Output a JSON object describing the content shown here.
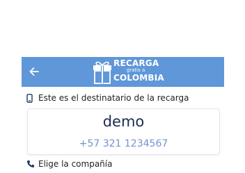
{
  "header": {
    "logo": {
      "line1": "RECARGA",
      "line2": "gratis a",
      "line3": "COLOMBIA"
    },
    "colors": {
      "bar": "#5f97d9"
    }
  },
  "recipient_section": {
    "label": "Este es el destinatario de la recarga",
    "icon": "phone-icon"
  },
  "recipient_card": {
    "name": "demo",
    "phone": "+57 321 1234567"
  },
  "company_section": {
    "label": "Elige la compañía",
    "icon": "phone-handset-icon"
  }
}
